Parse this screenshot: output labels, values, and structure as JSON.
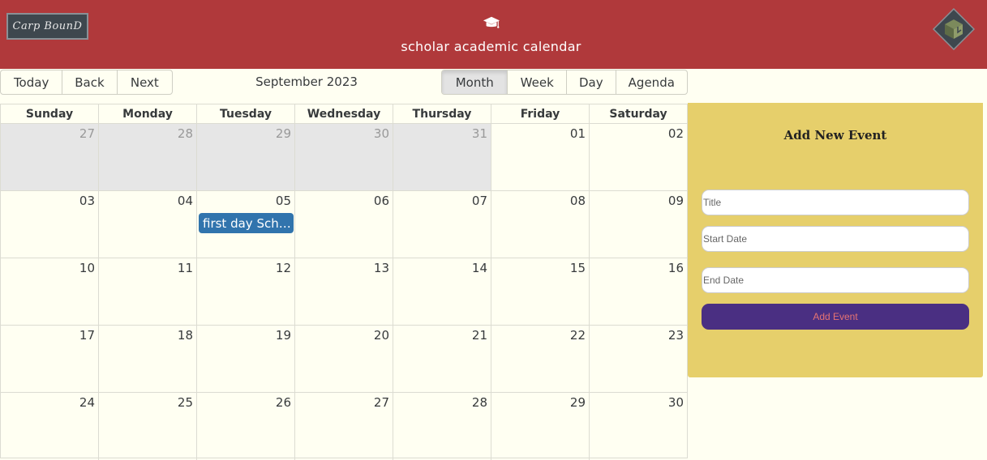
{
  "header": {
    "logo_text": "Carp BounD",
    "title": "scholar academic calendar",
    "hat_icon": "graduation-cap-icon",
    "avatar_icon": "cube-logo-icon"
  },
  "toolbar": {
    "today": "Today",
    "back": "Back",
    "next": "Next",
    "label": "September 2023",
    "views": [
      "Month",
      "Week",
      "Day",
      "Agenda"
    ],
    "active_view": "Month"
  },
  "calendar": {
    "days_of_week": [
      "Sunday",
      "Monday",
      "Tuesday",
      "Wednesday",
      "Thursday",
      "Friday",
      "Saturday"
    ],
    "weeks": [
      [
        {
          "n": "27",
          "off": true
        },
        {
          "n": "28",
          "off": true
        },
        {
          "n": "29",
          "off": true
        },
        {
          "n": "30",
          "off": true
        },
        {
          "n": "31",
          "off": true
        },
        {
          "n": "01"
        },
        {
          "n": "02"
        }
      ],
      [
        {
          "n": "03"
        },
        {
          "n": "04"
        },
        {
          "n": "05",
          "event": "first day School"
        },
        {
          "n": "06"
        },
        {
          "n": "07"
        },
        {
          "n": "08"
        },
        {
          "n": "09"
        }
      ],
      [
        {
          "n": "10"
        },
        {
          "n": "11"
        },
        {
          "n": "12"
        },
        {
          "n": "13"
        },
        {
          "n": "14"
        },
        {
          "n": "15"
        },
        {
          "n": "16"
        }
      ],
      [
        {
          "n": "17"
        },
        {
          "n": "18"
        },
        {
          "n": "19"
        },
        {
          "n": "20"
        },
        {
          "n": "21"
        },
        {
          "n": "22"
        },
        {
          "n": "23"
        }
      ],
      [
        {
          "n": "24"
        },
        {
          "n": "25"
        },
        {
          "n": "26"
        },
        {
          "n": "27"
        },
        {
          "n": "28"
        },
        {
          "n": "29"
        },
        {
          "n": "30"
        }
      ]
    ]
  },
  "panel": {
    "title": "Add New Event",
    "title_placeholder": "Title",
    "start_placeholder": "Start Date",
    "end_placeholder": "End Date",
    "button": "Add Event"
  },
  "colors": {
    "header": "#b0393b",
    "panel": "#e6cf6b",
    "event": "#3174ad",
    "button": "#4a2f82"
  }
}
